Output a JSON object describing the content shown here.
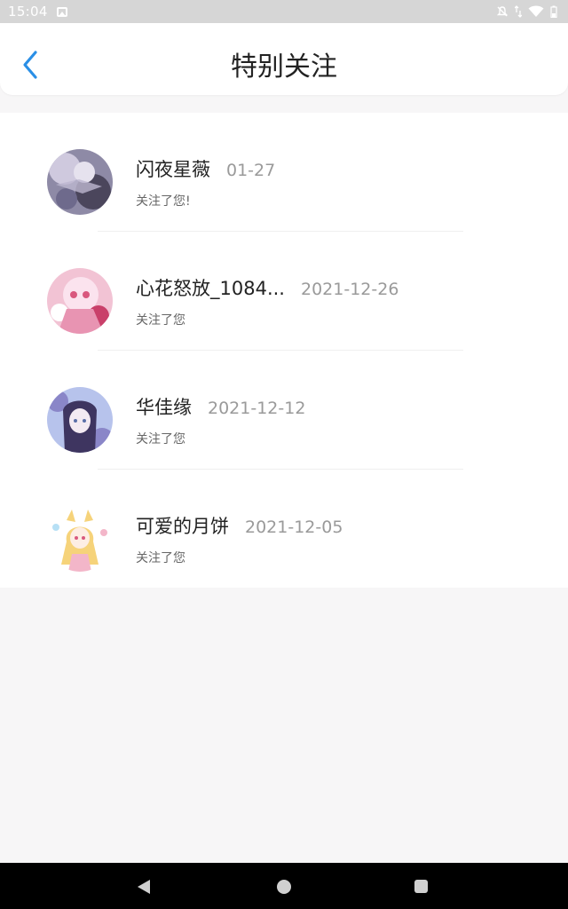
{
  "status_bar": {
    "time": "15:04",
    "icons": [
      "image-icon",
      "mute-icon",
      "data-arrows-icon",
      "wifi-icon",
      "battery-icon"
    ]
  },
  "header": {
    "title": "特别关注",
    "back_icon": "chevron-left-icon",
    "accent_color": "#2a8fe6"
  },
  "items": [
    {
      "name": "闪夜星薇",
      "date": "01-27",
      "message": "关注了您!",
      "avatar_colors": [
        "#6e6a8c",
        "#c9c3da",
        "#3a3646"
      ]
    },
    {
      "name": "心花怒放_1084...",
      "date": "2021-12-26",
      "message": "关注了您",
      "avatar_colors": [
        "#f2b9cf",
        "#d9587e",
        "#fbe3ee"
      ]
    },
    {
      "name": "华佳缘",
      "date": "2021-12-12",
      "message": "关注了您",
      "avatar_colors": [
        "#8a86c8",
        "#c7d4f2",
        "#3e3560"
      ]
    },
    {
      "name": "可爱的月饼",
      "date": "2021-12-05",
      "message": "关注了您",
      "avatar_colors": [
        "#f6d37a",
        "#f3b6c9",
        "#ffffff"
      ]
    }
  ],
  "nav_bar": {
    "back": "back-triangle-icon",
    "home": "home-circle-icon",
    "recents": "recents-square-icon"
  }
}
